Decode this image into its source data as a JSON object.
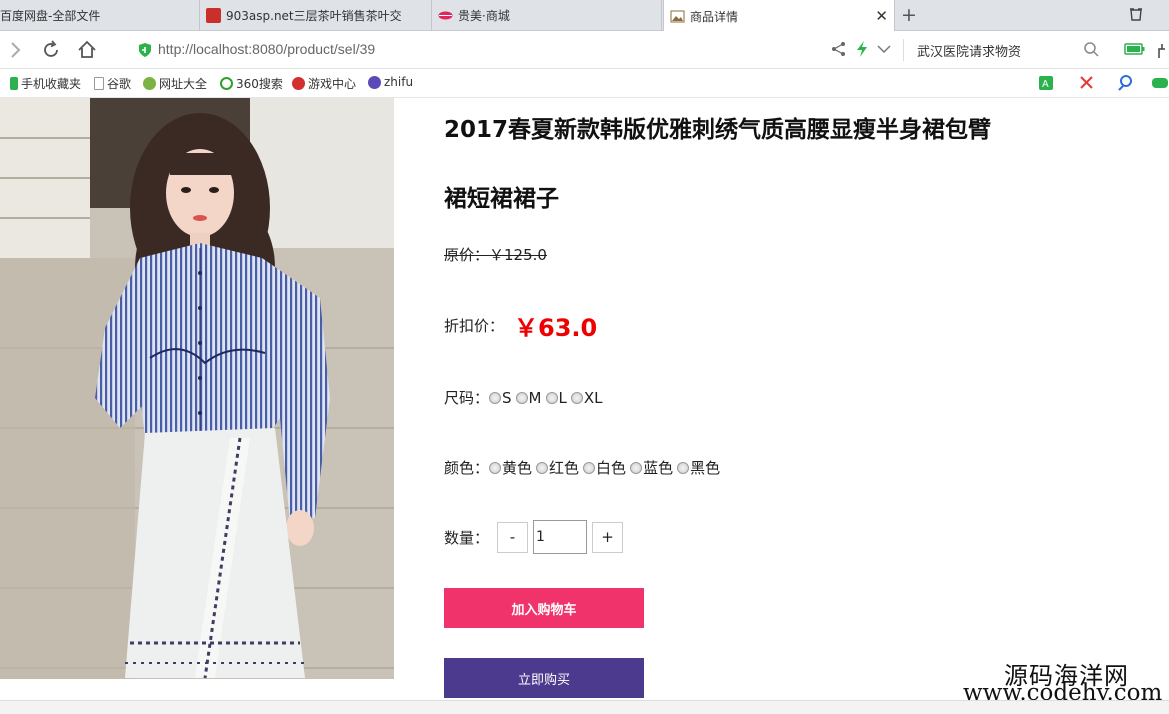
{
  "tabs": [
    {
      "label": "百度网盘-全部文件",
      "favicon_color": "#3385ff"
    },
    {
      "label": "903asp.net三层茶叶销售茶叶交",
      "favicon_color": "#c9302c"
    },
    {
      "label": "贵美·商城",
      "favicon_color": "#e0245e"
    },
    {
      "label": "商品详情",
      "favicon_color": "#8a6d3b",
      "active": true
    }
  ],
  "address": {
    "url_host": "http://localhost",
    "url_rest": ":8080/product/sel/39",
    "search_text": "武汉医院请求物资"
  },
  "bookmarks": [
    {
      "label": "手机收藏夹",
      "color": "#2bb24c"
    },
    {
      "label": "谷歌",
      "color": "#999"
    },
    {
      "label": "网址大全",
      "color": "#7cb342"
    },
    {
      "label": "360搜索",
      "color": "#29a329"
    },
    {
      "label": "游戏中心",
      "color": "#d32f2f"
    },
    {
      "label": "zhifu",
      "color": "#5b4ab8"
    }
  ],
  "product": {
    "title": "2017春夏新款韩版优雅刺绣气质高腰显瘦半身裙包臂裙短裙裙子",
    "original_price_label": "原价：",
    "original_price": "￥125.0",
    "discount_price_label": "折扣价：",
    "discount_price": "￥63.0",
    "size_label": "尺码：",
    "sizes": [
      "S",
      "M",
      "L",
      "XL"
    ],
    "color_label": "颜色：",
    "colors": [
      "黄色",
      "红色",
      "白色",
      "蓝色",
      "黑色"
    ],
    "quantity_label": "数量：",
    "quantity_minus": "-",
    "quantity_value": "1",
    "quantity_plus": "+",
    "add_to_cart": "加入购物车",
    "buy_now": "立即购买"
  },
  "watermark": {
    "line1": "源码海洋网",
    "line2": "www.codehy.com"
  },
  "colors": {
    "discount": "#ee0000",
    "cart_button": "#f0336b",
    "buy_button": "#4c3a8e"
  }
}
